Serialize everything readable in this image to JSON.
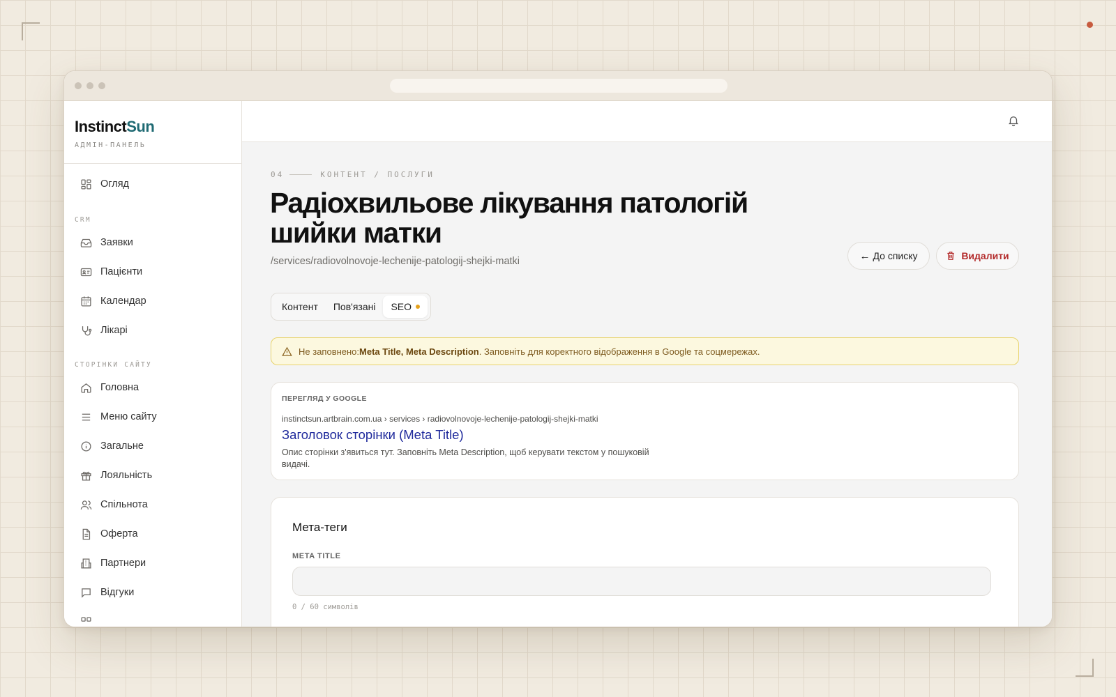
{
  "brand": {
    "name_part1": "Instinct",
    "name_part2": "Sun",
    "subtitle": "АДМІН-ПАНЕЛЬ"
  },
  "sidebar": {
    "overview": {
      "label": "Огляд",
      "icon": "grid-icon"
    },
    "crm_section": "CRM",
    "crm_items": [
      {
        "label": "Заявки",
        "icon": "inbox-icon"
      },
      {
        "label": "Пацієнти",
        "icon": "id-card-icon"
      },
      {
        "label": "Календар",
        "icon": "calendar-icon"
      },
      {
        "label": "Лікарі",
        "icon": "stethoscope-icon"
      }
    ],
    "pages_section": "СТОРІНКИ САЙТУ",
    "page_items": [
      {
        "label": "Головна",
        "icon": "home-icon"
      },
      {
        "label": "Меню сайту",
        "icon": "menu-icon"
      },
      {
        "label": "Загальне",
        "icon": "info-icon"
      },
      {
        "label": "Лояльність",
        "icon": "gift-icon"
      },
      {
        "label": "Спільнота",
        "icon": "users-icon"
      },
      {
        "label": "Оферта",
        "icon": "document-icon"
      },
      {
        "label": "Партнери",
        "icon": "building-icon"
      },
      {
        "label": "Відгуки",
        "icon": "message-icon"
      }
    ]
  },
  "header": {
    "step": "04",
    "breadcrumb": "КОНТЕНТ / ПОСЛУГИ",
    "title": "Радіохвильове лікування патологій шийки матки",
    "slug": "/services/radiovolnovoje-lechenije-patologij-shejki-matki"
  },
  "actions": {
    "back_label": "До списку",
    "back_arrow": "←",
    "delete_label": "Видалити"
  },
  "tabs": [
    {
      "label": "Контент"
    },
    {
      "label": "Пов'язані"
    },
    {
      "label": "SEO"
    }
  ],
  "alert": {
    "prefix": "Не заповнено: ",
    "fields": "Meta Title, Meta Description",
    "suffix": ". Заповніть для коректного відображення в Google та соцмережах."
  },
  "google_preview": {
    "caption": "ПЕРЕГЛЯД У GOOGLE",
    "url": "instinctsun.artbrain.com.ua › services › radiovolnovoje-lechenije-patologij-shejki-matki",
    "title": "Заголовок сторінки (Meta Title)",
    "description": "Опис сторінки з'явиться тут. Заповніть Meta Description, щоб керувати текстом у пошуковій видачі."
  },
  "meta_tags": {
    "heading": "Мета-теги",
    "meta_title_label": "META TITLE",
    "meta_title_value": "",
    "counter": "0 / 60 символів"
  },
  "colors": {
    "accent": "#1f6a73",
    "danger": "#b32b2b",
    "warning_bg": "#fcf8df",
    "warning_border": "#e8d36c",
    "seo_dot": "#e6a21c",
    "link": "#1f2a9c"
  }
}
